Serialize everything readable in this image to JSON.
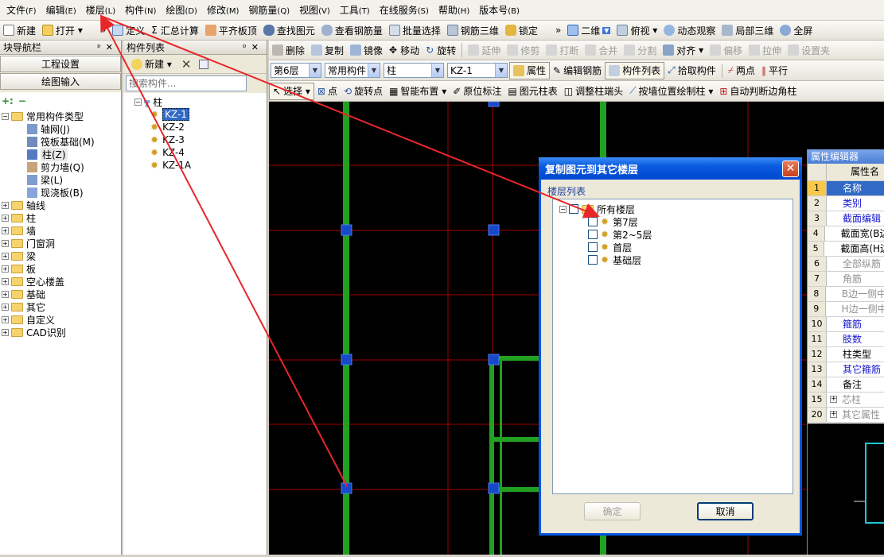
{
  "menubar": {
    "items": [
      {
        "label": "文件",
        "acc": "(F)"
      },
      {
        "label": "编辑",
        "acc": "(E)"
      },
      {
        "label": "楼层",
        "acc": "(L)"
      },
      {
        "label": "构件",
        "acc": "(N)"
      },
      {
        "label": "绘图",
        "acc": "(D)"
      },
      {
        "label": "修改",
        "acc": "(M)"
      },
      {
        "label": "钢筋量",
        "acc": "(Q)"
      },
      {
        "label": "视图",
        "acc": "(V)"
      },
      {
        "label": "工具",
        "acc": "(T)"
      },
      {
        "label": "在线服务",
        "acc": "(S)"
      },
      {
        "label": "帮助",
        "acc": "(H)"
      },
      {
        "label": "版本号",
        "acc": "(B)"
      }
    ]
  },
  "toolbar1": {
    "new": "新建",
    "open": "打开",
    "define": "定义",
    "sum": "汇总计算",
    "flat_board": "平齐板顶",
    "find": "查找图元",
    "view_rebar": "查看钢筋量",
    "batch": "批量选择",
    "rebar3d": "钢筋三维",
    "lock": "锁定",
    "view2d": "二维",
    "top_view": "俯视",
    "dyn_observe": "动态观察",
    "local3d": "局部三维",
    "fullscreen": "全屏",
    "more": "»"
  },
  "toolbar2": {
    "delete": "删除",
    "copy": "复制",
    "mirror": "镜像",
    "move": "移动",
    "rotate": "旋转",
    "extend": "延伸",
    "trim": "修剪",
    "break": "打断",
    "merge": "合并",
    "split": "分割",
    "align": "对齐",
    "offset": "偏移",
    "stretch": "拉伸",
    "set_point": "设置夹"
  },
  "toolbar3": {
    "floor": "第6层",
    "category": "常用构件",
    "type": "柱",
    "component": "KZ-1",
    "props": "属性",
    "edit_rebar": "编辑钢筋",
    "comp_list": "构件列表",
    "pick": "拾取构件",
    "two_points": "两点",
    "parallel": "平行"
  },
  "toolbar4": {
    "select": "选择",
    "point": "点",
    "rot_point": "旋转点",
    "smart": "智能布置",
    "orig_mark": "原位标注",
    "elem_table": "图元柱表",
    "adjust_end": "调整柱端头",
    "draw_by_wall": "按墙位置绘制柱",
    "auto_corner": "自动判断边角柱"
  },
  "nav": {
    "title": "块导航栏",
    "btn_settings": "工程设置",
    "btn_draw": "绘图输入",
    "tree": {
      "root": "常用构件类型",
      "children": [
        "轴网(J)",
        "筏板基础(M)",
        "柱(Z)",
        "剪力墙(Q)",
        "梁(L)",
        "现浇板(B)"
      ],
      "groups": [
        "轴线",
        "柱",
        "墙",
        "门窗洞",
        "梁",
        "板",
        "空心楼盖",
        "基础",
        "其它",
        "自定义",
        "CAD识别"
      ]
    }
  },
  "complist": {
    "title": "构件列表",
    "new": "新建",
    "search_placeholder": "搜索构件...",
    "root": "柱",
    "items": [
      "KZ-1",
      "KZ-2",
      "KZ-3",
      "KZ-4",
      "KZ-1A"
    ]
  },
  "dialog": {
    "title": "复制图元到其它楼层",
    "group_label": "楼层列表",
    "root": "所有楼层",
    "floors": [
      "第7层",
      "第2~5层",
      "首层",
      "基础层"
    ],
    "ok": "确定",
    "cancel": "取消"
  },
  "prop": {
    "title": "属性编辑器",
    "header": "属性名",
    "rows": [
      {
        "n": "1",
        "name": "名称",
        "style": "blue"
      },
      {
        "n": "2",
        "name": "类别",
        "style": "blue"
      },
      {
        "n": "3",
        "name": "截面编辑",
        "style": "blue"
      },
      {
        "n": "4",
        "name": "截面宽(B边",
        "style": "normal"
      },
      {
        "n": "5",
        "name": "截面高(H边",
        "style": "normal"
      },
      {
        "n": "6",
        "name": "全部纵筋",
        "style": "gray"
      },
      {
        "n": "7",
        "name": "角筋",
        "style": "gray"
      },
      {
        "n": "8",
        "name": "B边一侧中",
        "style": "gray"
      },
      {
        "n": "9",
        "name": "H边一侧中",
        "style": "gray"
      },
      {
        "n": "10",
        "name": "箍筋",
        "style": "blue"
      },
      {
        "n": "11",
        "name": "肢数",
        "style": "blue"
      },
      {
        "n": "12",
        "name": "柱类型",
        "style": "normal"
      },
      {
        "n": "13",
        "name": "其它箍筋",
        "style": "blue"
      },
      {
        "n": "14",
        "name": "备注",
        "style": "normal"
      },
      {
        "n": "15",
        "name": "芯柱",
        "style": "gray"
      },
      {
        "n": "20",
        "name": "其它属性",
        "style": "gray"
      }
    ]
  },
  "colors": {
    "accent": "#0a5be0",
    "selection": "#316ac5",
    "grid_red": "#c00000",
    "wall_green": "#21a021",
    "column_blue": "#1648c8"
  }
}
